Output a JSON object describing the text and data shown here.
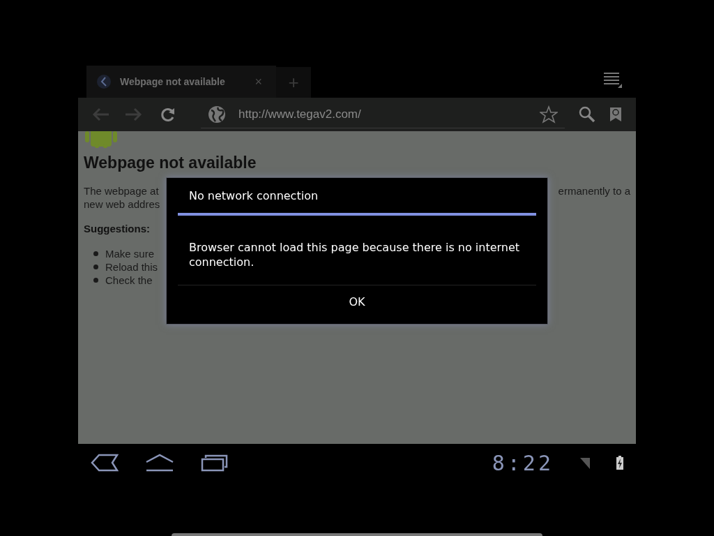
{
  "browser": {
    "tabs": [
      {
        "title": "Webpage not available",
        "close": "×",
        "selected": true
      }
    ],
    "new_tab": "+",
    "url": "http://www.tegav2.com/"
  },
  "page": {
    "heading": "Webpage not available",
    "paragraph_lines": [
      {
        "left": "The webpage at",
        "right": "ermanently to a"
      },
      {
        "left": "new web addres"
      }
    ],
    "suggestions_label": "Suggestions:",
    "bullets": [
      "Make sure",
      "Reload this",
      "Check the"
    ]
  },
  "dialog": {
    "title": "No network connection",
    "message": "Browser cannot load this page because there is no internet connection.",
    "button": "OK"
  },
  "system_bar": {
    "clock": "8:22"
  }
}
